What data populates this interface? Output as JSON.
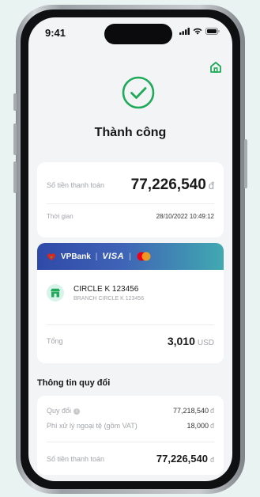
{
  "status_bar": {
    "time": "9:41"
  },
  "header": {
    "title": "Thành công"
  },
  "payment": {
    "amount_label": "Số tiền thanh toán",
    "amount": "77,226,540",
    "amount_currency": "đ",
    "time_label": "Thời gian",
    "time_value": "28/10/2022 10:49:12"
  },
  "card": {
    "bank_name": "VPBank",
    "network": "VISA",
    "divider": "|",
    "merchant_name": "CIRCLE K 123456",
    "merchant_branch": "BRANCH CIRCLE K 123456",
    "total_label": "Tổng",
    "total_amount": "3,010",
    "total_currency": "USD"
  },
  "conversion": {
    "section_title": "Thông tin quy đổi",
    "rate_label": "Quy đổi",
    "rate_info_glyph": "i",
    "rate_value": "77,218,540",
    "rate_currency": "đ",
    "fee_label": "Phí xử lý ngoại tệ (gồm VAT)",
    "fee_value": "18,000",
    "fee_currency": "đ",
    "final_label": "Số tiền thanh toán",
    "final_value": "77,226,540",
    "final_currency": "đ"
  },
  "colors": {
    "accent_green": "#1faa59",
    "bank_gradient_start": "#2f49a8",
    "bank_gradient_end": "#41a9b1"
  }
}
